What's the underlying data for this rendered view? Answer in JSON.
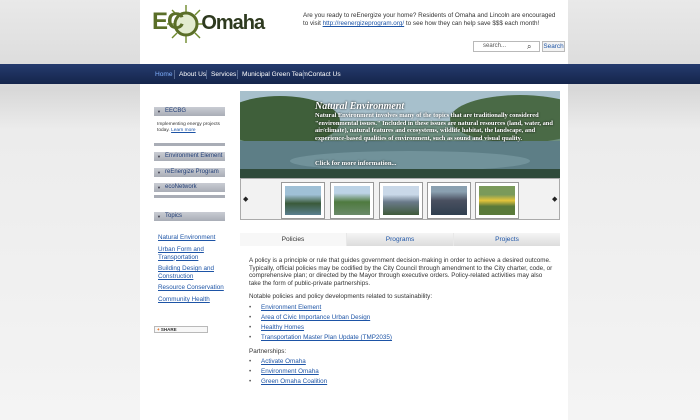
{
  "header": {
    "logo_eco": "EC",
    "logo_omaha": "Omaha",
    "intro_before": "Are you ready to reEnergize your home?  Residents of Omaha and Lincoln are encouraged to visit",
    "intro_link": "http://reenergizeprogram.org/",
    "intro_after": " to see how they can help save $$$ each month!",
    "search_placeholder": "search...",
    "search_button": "Search"
  },
  "nav": [
    "Home",
    "About Us",
    "Services",
    "Municipal Green Team",
    "Contact Us"
  ],
  "sidebar": {
    "eeobg_label": "EECBG",
    "eeobg_text": "Implementing energy projects today.",
    "eeobg_link": "Learn more",
    "items": [
      "Environment Element",
      "reEnergize Program",
      "ecoNetwork"
    ],
    "topics_label": "Topics",
    "topics": [
      "Natural Environment",
      "Urban Form and Transportation",
      "Building Design and Construction",
      "Resource Conservation",
      "Community Health"
    ],
    "share_label": "SHARE"
  },
  "hero": {
    "title": "Natural Environment",
    "text": "Natural Environment involves many of the topics that are traditionally considered \"environmental issues.\" Included in these issues are natural resources (land, water, and air/climate), natural features and ecosystems, wildlife habitat, the landscape, and experience-based qualities of environment, such as sound and visual quality.",
    "more": "Click for  more information...",
    "prev_arrow": "◆",
    "next_arrow": "◆"
  },
  "tabs": [
    "Policies",
    "Programs",
    "Projects"
  ],
  "content": {
    "intro": "A policy is a principle or rule that guides government decision-making in order to achieve a desired outcome. Typically, official policies may be codified by the City Council through amendment to the City charter, code, or comprehensive plan; or directed by the Mayor through executive orders. Policy-related activities may also take the form of public-private partnerships.",
    "notable": "Notable policies and policy developments related to sustainability:",
    "policies": [
      "Environment Element",
      "Area of Civic Importance Urban Design",
      "Healthy Homes",
      "Transportation Master Plan Update (TMP2035)"
    ],
    "partnerships_label": "Partnerships:",
    "partnerships": [
      "Activate Omaha",
      "Environment Omaha",
      "Green Omaha Coalition"
    ]
  }
}
